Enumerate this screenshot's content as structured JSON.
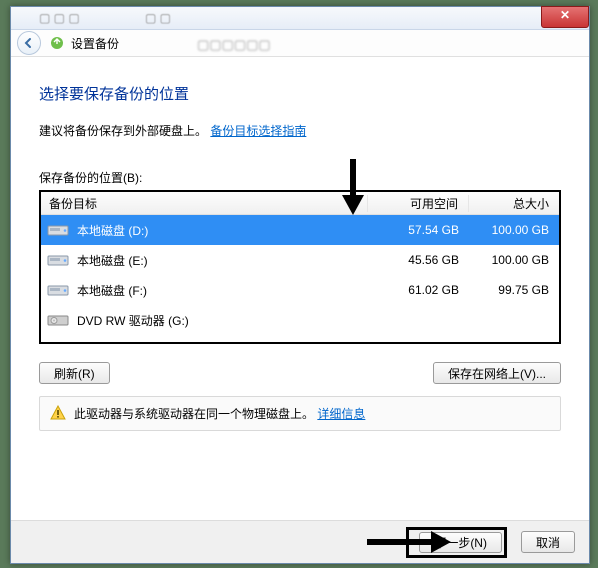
{
  "window": {
    "close_glyph": "✕",
    "header_title": "设置备份"
  },
  "page": {
    "title": "选择要保存备份的位置",
    "desc_prefix": "建议将备份保存到外部硬盘上。",
    "desc_link": "备份目标选择指南",
    "list_label": "保存备份的位置(B):"
  },
  "columns": {
    "target": "备份目标",
    "free": "可用空间",
    "total": "总大小"
  },
  "drives": [
    {
      "name": "本地磁盘 (D:)",
      "free": "57.54 GB",
      "total": "100.00 GB",
      "type": "hdd",
      "selected": true
    },
    {
      "name": "本地磁盘 (E:)",
      "free": "45.56 GB",
      "total": "100.00 GB",
      "type": "hdd",
      "selected": false
    },
    {
      "name": "本地磁盘 (F:)",
      "free": "61.02 GB",
      "total": "99.75 GB",
      "type": "hdd",
      "selected": false
    },
    {
      "name": "DVD RW 驱动器 (G:)",
      "free": "",
      "total": "",
      "type": "dvd",
      "selected": false
    }
  ],
  "buttons": {
    "refresh": "刷新(R)",
    "network": "保存在网络上(V)...",
    "next": "下一步(N)",
    "cancel": "取消"
  },
  "warning": {
    "text": "此驱动器与系统驱动器在同一个物理磁盘上。",
    "link": "详细信息"
  }
}
